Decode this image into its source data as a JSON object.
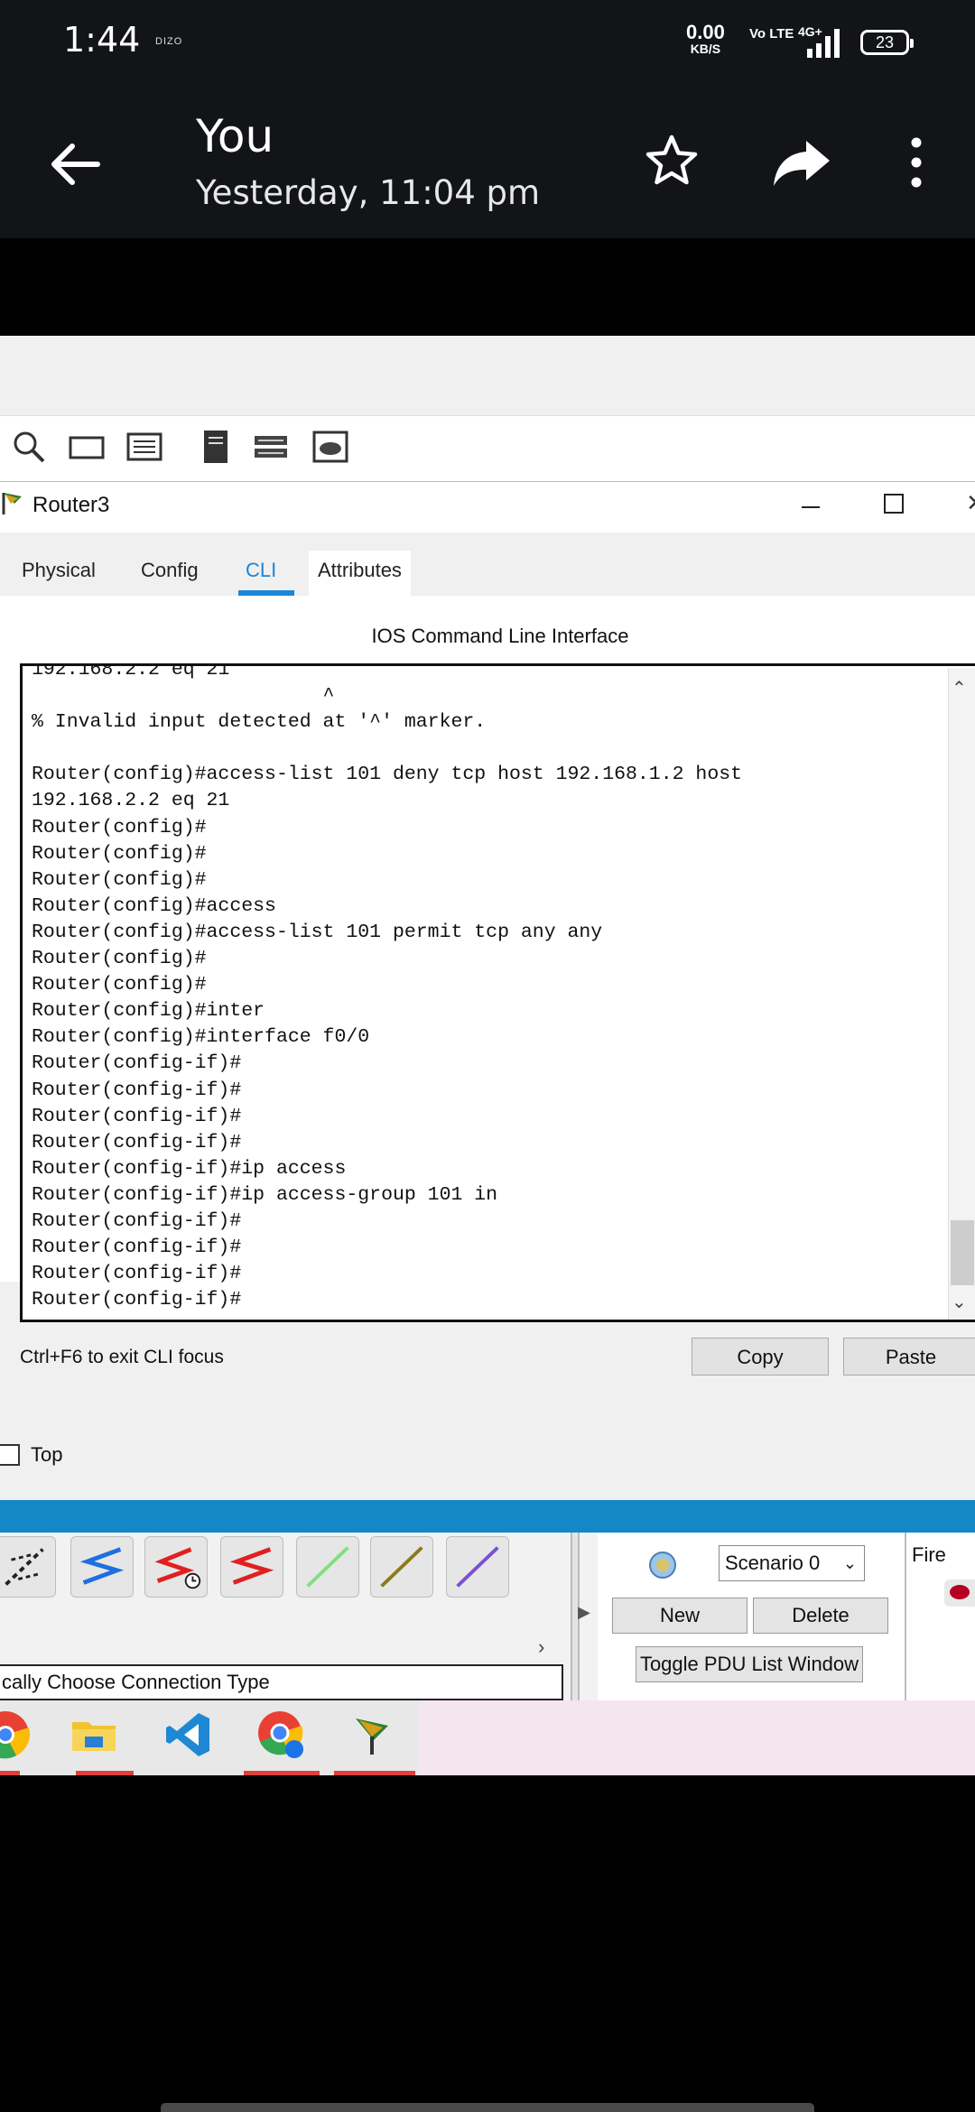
{
  "status_bar": {
    "time": "1:44",
    "brand": "DIZO",
    "speed": "0.00",
    "speed_unit": "KB/S",
    "volte": "Vo LTE",
    "network": "4G+",
    "battery": "23"
  },
  "header": {
    "title": "You",
    "subtitle": "Yesterday, 11:04 pm",
    "icons": [
      "back-arrow-icon",
      "star-icon",
      "share-icon",
      "more-icon"
    ]
  },
  "router_window": {
    "title": "Router3",
    "tabs": [
      "Physical",
      "Config",
      "CLI",
      "Attributes"
    ],
    "active_tab": "CLI",
    "cli_heading": "IOS Command Line Interface",
    "terminal_text": "192.168.2.2 eq 21\n                         ^\n% Invalid input detected at '^' marker.\n\nRouter(config)#access-list 101 deny tcp host 192.168.1.2 host\n192.168.2.2 eq 21\nRouter(config)#\nRouter(config)#\nRouter(config)#\nRouter(config)#access\nRouter(config)#access-list 101 permit tcp any any\nRouter(config)#\nRouter(config)#\nRouter(config)#inter\nRouter(config)#interface f0/0\nRouter(config-if)#\nRouter(config-if)#\nRouter(config-if)#\nRouter(config-if)#\nRouter(config-if)#ip access\nRouter(config-if)#ip access-group 101 in\nRouter(config-if)#\nRouter(config-if)#\nRouter(config-if)#\nRouter(config-if)#",
    "hint": "Ctrl+F6 to exit CLI focus",
    "copy_label": "Copy",
    "paste_label": "Paste",
    "top_label": "Top"
  },
  "bottom_panel": {
    "connection_type": "cally Choose Connection Type",
    "scenario": "Scenario 0",
    "new_label": "New",
    "delete_label": "Delete",
    "toggle_label": "Toggle PDU List Window",
    "fire_label": "Fire"
  },
  "colors": {
    "accent": "#1a86d8",
    "bluebar": "#1289c6",
    "header_bg": "#121417"
  }
}
